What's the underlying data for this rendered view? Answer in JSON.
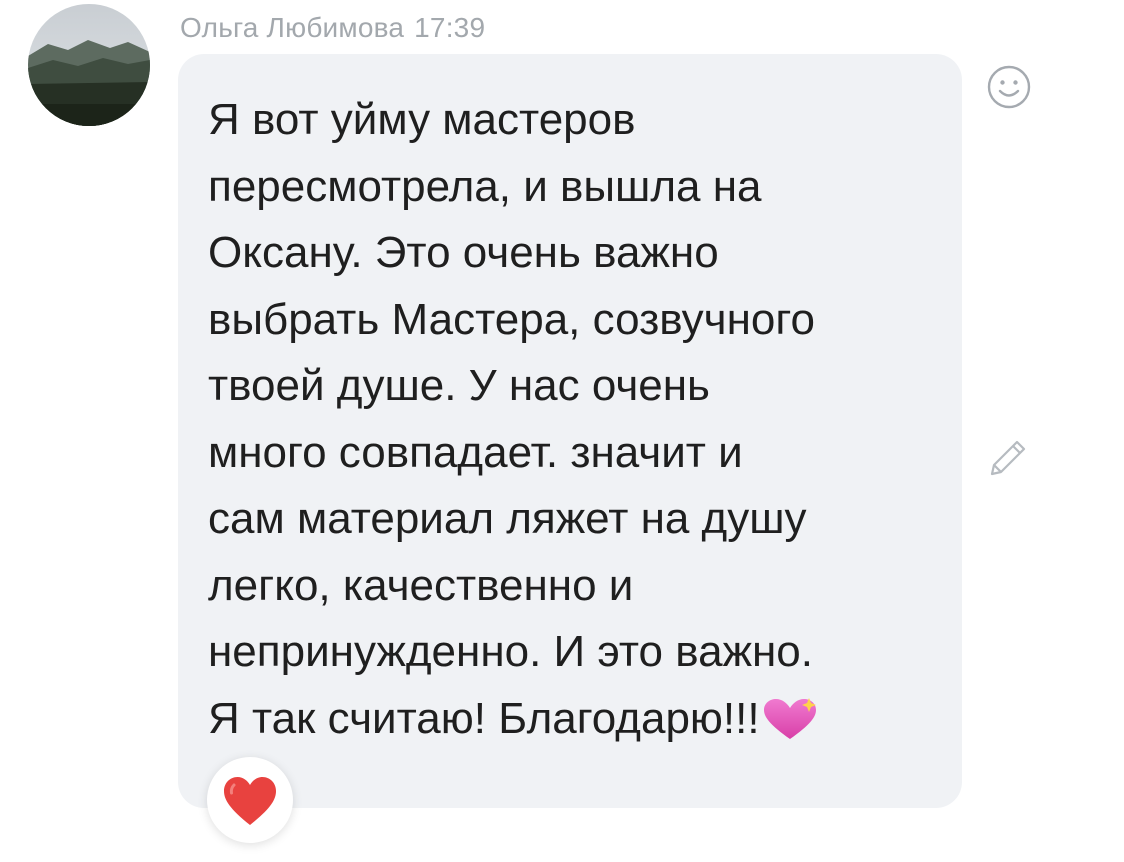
{
  "message": {
    "author": "Ольга Любимова",
    "time": "17:39",
    "lines": [
      "Я вот уйму мастеров",
      "пересмотрела, и вышла на",
      "Оксану. Это очень важно",
      "выбрать Мастера, созвучного",
      "твоей душе. У нас очень",
      "много совпадает. значит и",
      "сам материал ляжет на душу",
      "легко, качественно и",
      "непринужденно. И это важно.",
      "Я так считаю! Благодарю!!!"
    ],
    "inline_emoji": "sparkling-heart"
  },
  "reaction": {
    "emoji": "red-heart"
  },
  "icons": {
    "emoji_button": "smiley-icon",
    "edit_button": "pencil-icon"
  },
  "colors": {
    "bubble": "#f0f2f5",
    "text": "#1f1f1f",
    "meta": "#a3a8ad",
    "heart_red": "#e8423f",
    "heart_pink": "#e455b8"
  }
}
